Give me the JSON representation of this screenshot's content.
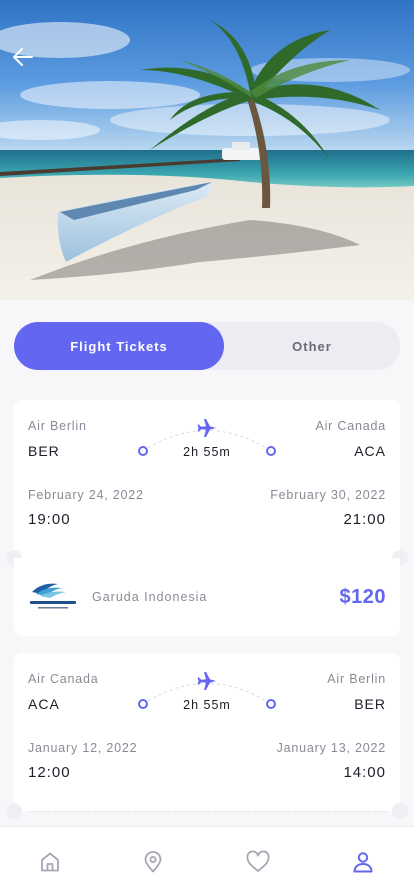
{
  "header": {
    "back_icon": "arrow-left-icon"
  },
  "tabs": [
    {
      "label": "Flight Tickets",
      "active": true
    },
    {
      "label": "Other",
      "active": false
    }
  ],
  "tickets": [
    {
      "from_airline": "Air Berlin",
      "from_code": "BER",
      "to_airline": "Air Canada",
      "to_code": "ACA",
      "duration": "2h 55m",
      "depart_date": "February 24, 2022",
      "arrive_date": "February 30, 2022",
      "depart_time": "19:00",
      "arrive_time": "21:00",
      "carrier": "Garuda Indonesia",
      "price": "$120"
    },
    {
      "from_airline": "Air Canada",
      "from_code": "ACA",
      "to_airline": "Air Berlin",
      "to_code": "BER",
      "duration": "2h 55m",
      "depart_date": "January 12, 2022",
      "arrive_date": "January 13, 2022",
      "depart_time": "12:00",
      "arrive_time": "14:00"
    }
  ],
  "nav": [
    {
      "icon": "home-icon",
      "active": false
    },
    {
      "icon": "location-pin-icon",
      "active": false
    },
    {
      "icon": "heart-icon",
      "active": false
    },
    {
      "icon": "user-icon",
      "active": true
    }
  ],
  "colors": {
    "accent": "#6366f1",
    "inactive_icon": "#a6a6b4",
    "background": "#f7f7fa"
  }
}
